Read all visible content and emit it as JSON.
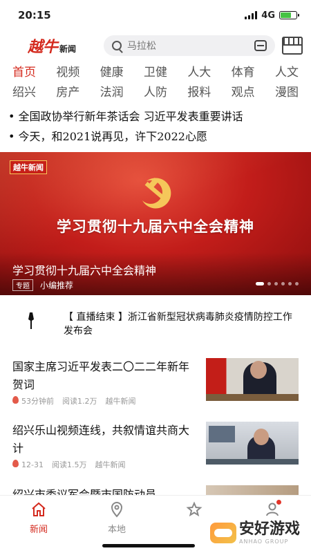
{
  "status": {
    "time": "20:15",
    "network": "4G"
  },
  "header": {
    "logo_mark": "越牛",
    "logo_text": "新闻",
    "search_placeholder": "马拉松"
  },
  "nav": {
    "row1": [
      "首页",
      "视频",
      "健康",
      "卫健",
      "人大",
      "体育",
      "人文"
    ],
    "row2": [
      "绍兴",
      "房产",
      "法润",
      "人防",
      "报料",
      "观点",
      "漫图"
    ]
  },
  "ticker": [
    "全国政协举行新年茶话会 习近平发表重要讲话",
    "今天，和2021说再见，许下2022心愿"
  ],
  "banner": {
    "logo": "越牛新闻",
    "headline": "学习贯彻十九届六中全会精神",
    "caption": "学习贯彻十九届六中全会精神",
    "tag": "专题",
    "source": "小编推荐",
    "slides": 6,
    "active_slide": 1
  },
  "live": {
    "text": "【 直播结束 】浙江省新型冠状病毒肺炎疫情防控工作发布会"
  },
  "news": [
    {
      "title": "国家主席习近平发表二〇二二年新年贺词",
      "time": "53分钟前",
      "reads": "阅读1.2万",
      "source": "越牛新闻"
    },
    {
      "title": "绍兴乐山视频连线，共叙情谊共商大计",
      "time": "12-31",
      "reads": "阅读1.5万",
      "source": "越牛新闻"
    }
  ],
  "partial_news": {
    "title": "绍兴市委议军会暨市国防动员"
  },
  "tabbar": {
    "news": "新闻",
    "local": "本地",
    "favorites": "",
    "profile": ""
  },
  "watermark": {
    "text": "安好游戏",
    "sub": "ANHAO GROUP"
  },
  "colors": {
    "accent": "#d42a1e",
    "banner": "#c21d1a"
  }
}
